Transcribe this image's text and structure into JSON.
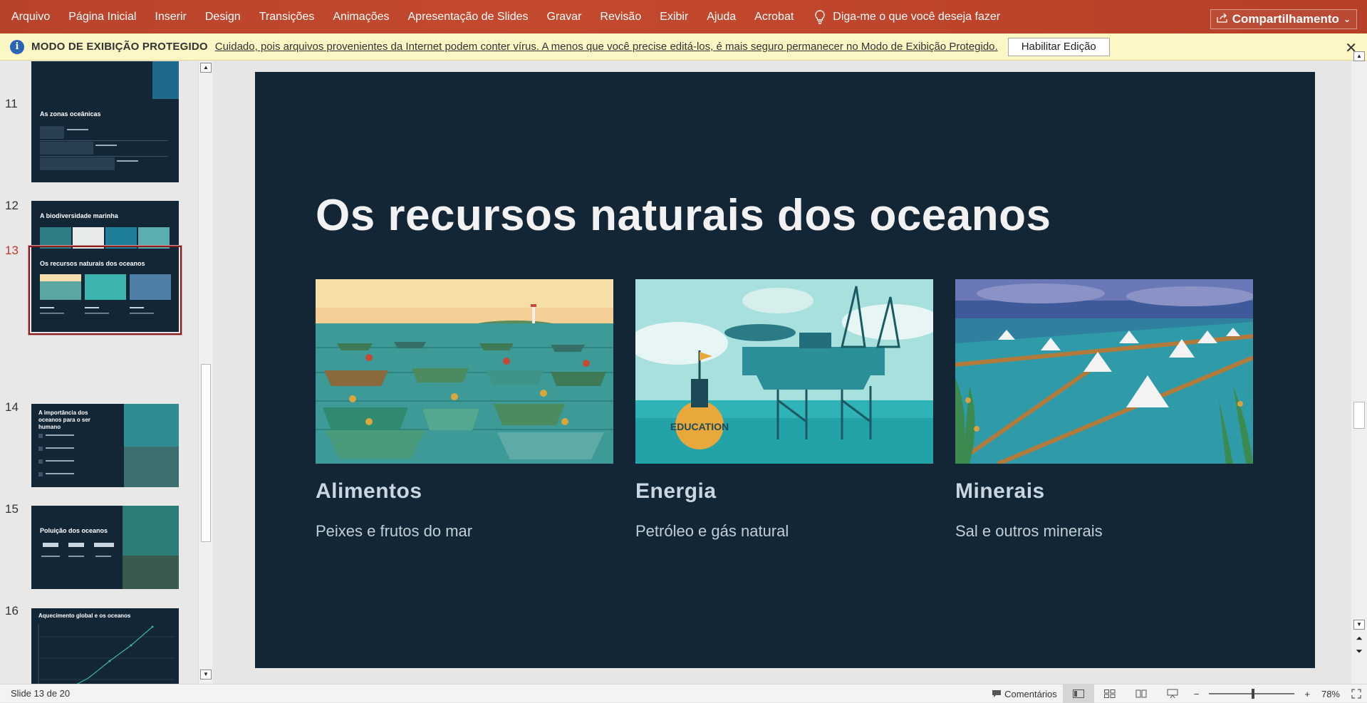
{
  "menu": {
    "tabs": [
      "Arquivo",
      "Página Inicial",
      "Inserir",
      "Design",
      "Transições",
      "Animações",
      "Apresentação de Slides",
      "Gravar",
      "Revisão",
      "Exibir",
      "Ajuda",
      "Acrobat"
    ],
    "tell_me": "Diga-me o que você deseja fazer",
    "share": "Compartilhamento"
  },
  "protected": {
    "title": "MODO DE EXIBIÇÃO PROTEGIDO",
    "message": "Cuidado, pois arquivos provenientes da Internet podem conter vírus. A menos que você precise editá-los, é mais seguro permanecer no Modo de  Exibição Protegido.",
    "enable_button": "Habilitar Edição"
  },
  "thumbnails": [
    {
      "num": "11",
      "title": "As zonas oceânicas"
    },
    {
      "num": "12",
      "title": "A biodiversidade marinha"
    },
    {
      "num": "13",
      "title": "Os recursos naturais dos oceanos"
    },
    {
      "num": "14",
      "title": "A importância dos oceanos para o ser humano"
    },
    {
      "num": "15",
      "title": "Poluição dos oceanos"
    },
    {
      "num": "16",
      "title": "Aquecimento global e os oceanos"
    }
  ],
  "slide": {
    "title": "Os recursos naturais dos oceanos",
    "cards": [
      {
        "heading": "Alimentos",
        "text": "Peixes e frutos do mar"
      },
      {
        "heading": "Energia",
        "text": "Petróleo e gás natural"
      },
      {
        "heading": "Minerais",
        "text": "Sal e outros minerais"
      }
    ],
    "energy_buoy_label": "EDUCATION"
  },
  "status": {
    "slide_info": "Slide 13 de 20",
    "comments": "Comentários",
    "zoom": "78%"
  }
}
